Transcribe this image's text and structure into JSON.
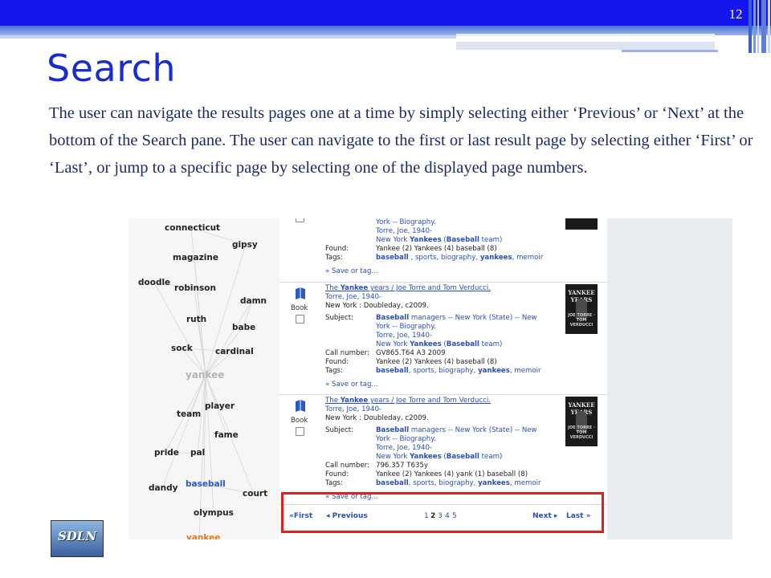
{
  "slide": {
    "number": "12",
    "title": "Search",
    "body": "The user can navigate the results pages one at a time by simply selecting either ‘Previous’ or ‘Next’ at the bottom of the Search pane. The user can navigate to the first or last result page by selecting either ‘First’ or ‘Last’, or jump to a specific page by selecting one of the displayed page numbers.",
    "logo_text": "SDLN"
  },
  "word_graph": {
    "words": [
      "connecticut",
      "gipsy",
      "magazine",
      "doodle",
      "robinson",
      "damn",
      "ruth",
      "babe",
      "sock",
      "cardinal",
      "yankee",
      "player",
      "team",
      "fame",
      "pride",
      "pal",
      "baseball",
      "dandy",
      "court",
      "olympus",
      "yankee"
    ]
  },
  "results": {
    "record0": {
      "subject_tail": "York -- Biography.",
      "author": "Torre, Joe, 1940-",
      "subject3_pre": "New York ",
      "subject3_b": "Yankees",
      "subject3_mid": " (",
      "subject3_b2": "Baseball",
      "subject3_post": " team)",
      "found_label": "Found:",
      "found": "Yankee (2) Yankees (4) baseball (8)",
      "tags_label": "Tags:",
      "tag1": "baseball",
      "tag2": "sports",
      "tag3": "biography",
      "tag4": "yankees",
      "tag5": "memoir",
      "save": "» Save or tag..."
    },
    "record1": {
      "format": "Book",
      "title_pre": "The ",
      "title_b": "Yankee",
      "title_post": " years / Joe Torre and Tom Verducci.",
      "author": "Torre, Joe, 1940-",
      "publisher": "New York : Doubleday, c2009.",
      "subject_label": "Subject:",
      "subj1_b": "Baseball",
      "subj1": " managers -- New York (State) -- New",
      "subj2": "York -- Biography.",
      "subj3": "Torre, Joe, 1940-",
      "subj4_pre": "New York ",
      "subj4_b": "Yankees",
      "subj4_mid": " (",
      "subj4_b2": "Baseball",
      "subj4_post": " team)",
      "call_label": "Call number:",
      "call": "GV865.T64 A3 2009",
      "found_label": "Found:",
      "found": "Yankee (2) Yankees (4) baseball (8)",
      "tags_label": "Tags:",
      "tag1": "baseball",
      "tag2": "sports",
      "tag3": "biography",
      "tag4": "yankees",
      "tag5": "memoir",
      "save": "» Save or tag...",
      "cover_title": "YANKEE YEARS",
      "cover_authors": "JOE TORRE · TOM VERDUCCI"
    },
    "record2": {
      "format": "Book",
      "title_pre": "The ",
      "title_b": "Yankee",
      "title_post": " years / Joe Torre and Tom Verducci.",
      "author": "Torre, Joe, 1940-",
      "publisher": "New York : Doubleday, c2009.",
      "subject_label": "Subject:",
      "subj1_b": "Baseball",
      "subj1": " managers -- New York (State) -- New",
      "subj2": "York -- Biography.",
      "subj3": "Torre, Joe, 1940-",
      "subj4_pre": "New York ",
      "subj4_b": "Yankees",
      "subj4_mid": " (",
      "subj4_b2": "Baseball",
      "subj4_post": " team)",
      "call_label": "Call number:",
      "call": "796.357 T635y",
      "found_label": "Found:",
      "found": "Yankee (2) Yankees (4) yank (1) baseball (8)",
      "tags_label": "Tags:",
      "tag1": "baseball",
      "tag2": "sports",
      "tag3": "biography",
      "tag4": "yankees",
      "tag5": "memoir",
      "save": "» Save or tag...",
      "cover_title": "YANKEE YEARS",
      "cover_authors": "JOE TORRE · TOM VERDUCCI"
    }
  },
  "pager": {
    "first": "First",
    "previous": "Previous",
    "pages": [
      "1",
      "2",
      "3",
      "4",
      "5"
    ],
    "current_page": "2",
    "next": "Next",
    "last": "Last",
    "arrow_first": "«",
    "arrow_prev": "◂",
    "arrow_next": "▸",
    "arrow_last": "»"
  },
  "colors": {
    "header_blue": "#1515ee",
    "title_blue": "#1a2cd0",
    "highlight_red": "#e02020",
    "link_blue": "#2a4fb8"
  }
}
